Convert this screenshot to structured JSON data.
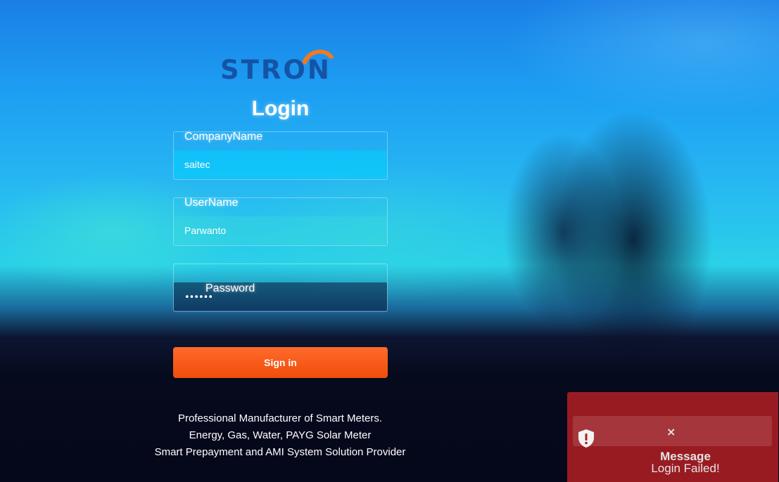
{
  "brand": {
    "logo_text": "STRON",
    "logo_color": "#1553a6",
    "arc_color": "#f07a22"
  },
  "login": {
    "title": "Login",
    "company": {
      "label": "CompanyName",
      "value": "saitec"
    },
    "username": {
      "label": "UserName",
      "value": "Parwanto"
    },
    "password": {
      "label": "Password",
      "masked": "••••••"
    },
    "sign_in_label": "Sign in",
    "button_color": "#f25510"
  },
  "tagline": {
    "line1": "Professional Manufacturer of Smart Meters.",
    "line2": "Energy, Gas, Water, PAYG Solar Meter",
    "line3": "Smart Prepayment and AMI System Solution Provider"
  },
  "toast": {
    "close_icon": "×",
    "icon": "shield-alert-icon",
    "title": "Message",
    "message": "Login Failed!",
    "color": "#aa1e23"
  }
}
